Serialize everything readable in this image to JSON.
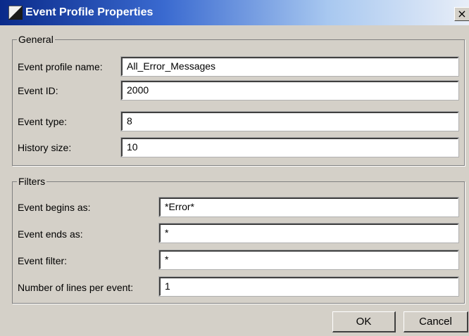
{
  "window": {
    "title": "Event Profile Properties",
    "close_label": "×",
    "icon": "event-profile-icon"
  },
  "general": {
    "legend": "General",
    "fields": [
      {
        "label": "Event profile name:",
        "value": "All_Error_Messages"
      },
      {
        "label": "Event ID:",
        "value": "2000"
      },
      {
        "label": "Event type:",
        "value": "8"
      },
      {
        "label": "History size:",
        "value": "10"
      }
    ]
  },
  "filters": {
    "legend": "Filters",
    "fields": [
      {
        "label": "Event begins as:",
        "value": "*Error*"
      },
      {
        "label": "Event ends as:",
        "value": "*"
      },
      {
        "label": "Event filter:",
        "value": "*"
      },
      {
        "label": "Number of lines per event:",
        "value": "1"
      }
    ]
  },
  "buttons": {
    "ok": "OK",
    "cancel": "Cancel"
  },
  "colors": {
    "dialog_bg": "#d4d0c8",
    "titlebar_start": "#0a2a8a",
    "titlebar_end": "#e8eef8",
    "title_text": "#ffffff"
  }
}
